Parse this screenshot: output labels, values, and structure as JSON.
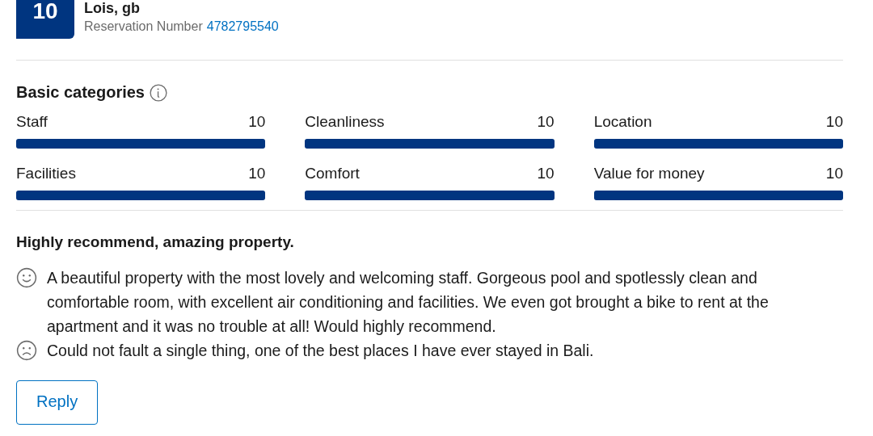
{
  "review": {
    "score": "10",
    "reviewer": "Lois, gb",
    "reservation_label": "Reservation Number",
    "reservation_number": "4782795540"
  },
  "categories": {
    "title": "Basic categories",
    "items": [
      {
        "name": "Staff",
        "score": "10",
        "level": 1
      },
      {
        "name": "Cleanliness",
        "score": "10",
        "level": 1
      },
      {
        "name": "Location",
        "score": "10",
        "level": 1
      },
      {
        "name": "Facilities",
        "score": "10",
        "level": 1
      },
      {
        "name": "Comfort",
        "score": "10",
        "level": 1
      },
      {
        "name": "Value for money",
        "score": "10",
        "level": 1
      }
    ]
  },
  "comment": {
    "title": "Highly recommend, amazing property.",
    "lines": [
      {
        "kind": "positive",
        "text": "A beautiful property with the most lovely and welcoming staff. Gorgeous pool and spotlessly clean and comfortable room, with excellent air conditioning and facilities. We even got brought a bike to rent at the apartment and it was no trouble at all! Would highly recommend."
      },
      {
        "kind": "negative",
        "text": "Could not fault a single thing, one of the best places I have ever stayed in Bali."
      }
    ]
  },
  "reply_button": "Reply"
}
